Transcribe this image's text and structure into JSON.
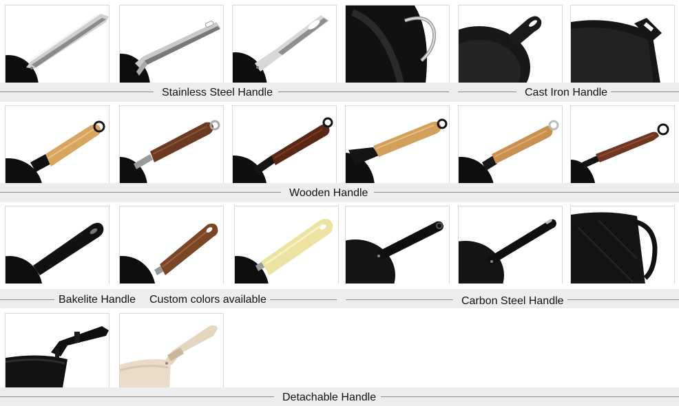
{
  "captions": {
    "stainless": "Stainless Steel Handle",
    "castiron": "Cast Iron Handle",
    "wooden": "Wooden Handle",
    "bakelite": "Bakelite Handle",
    "custom": "Custom colors available",
    "carbon": "Carbon Steel Handle",
    "detachable": "Detachable Handle"
  },
  "colors": {
    "pan_black": "#0c0c0c",
    "steel_light": "#e6e6e6",
    "steel_dark": "#6c6c6c",
    "wood_light": "#d9a45e",
    "wood_walnut": "#6a3b22",
    "wood_rosewood": "#5a2616",
    "bakelite_cream": "#ece3a3",
    "detachable_beige": "#eadbc6",
    "band_gray": "#ededed"
  }
}
